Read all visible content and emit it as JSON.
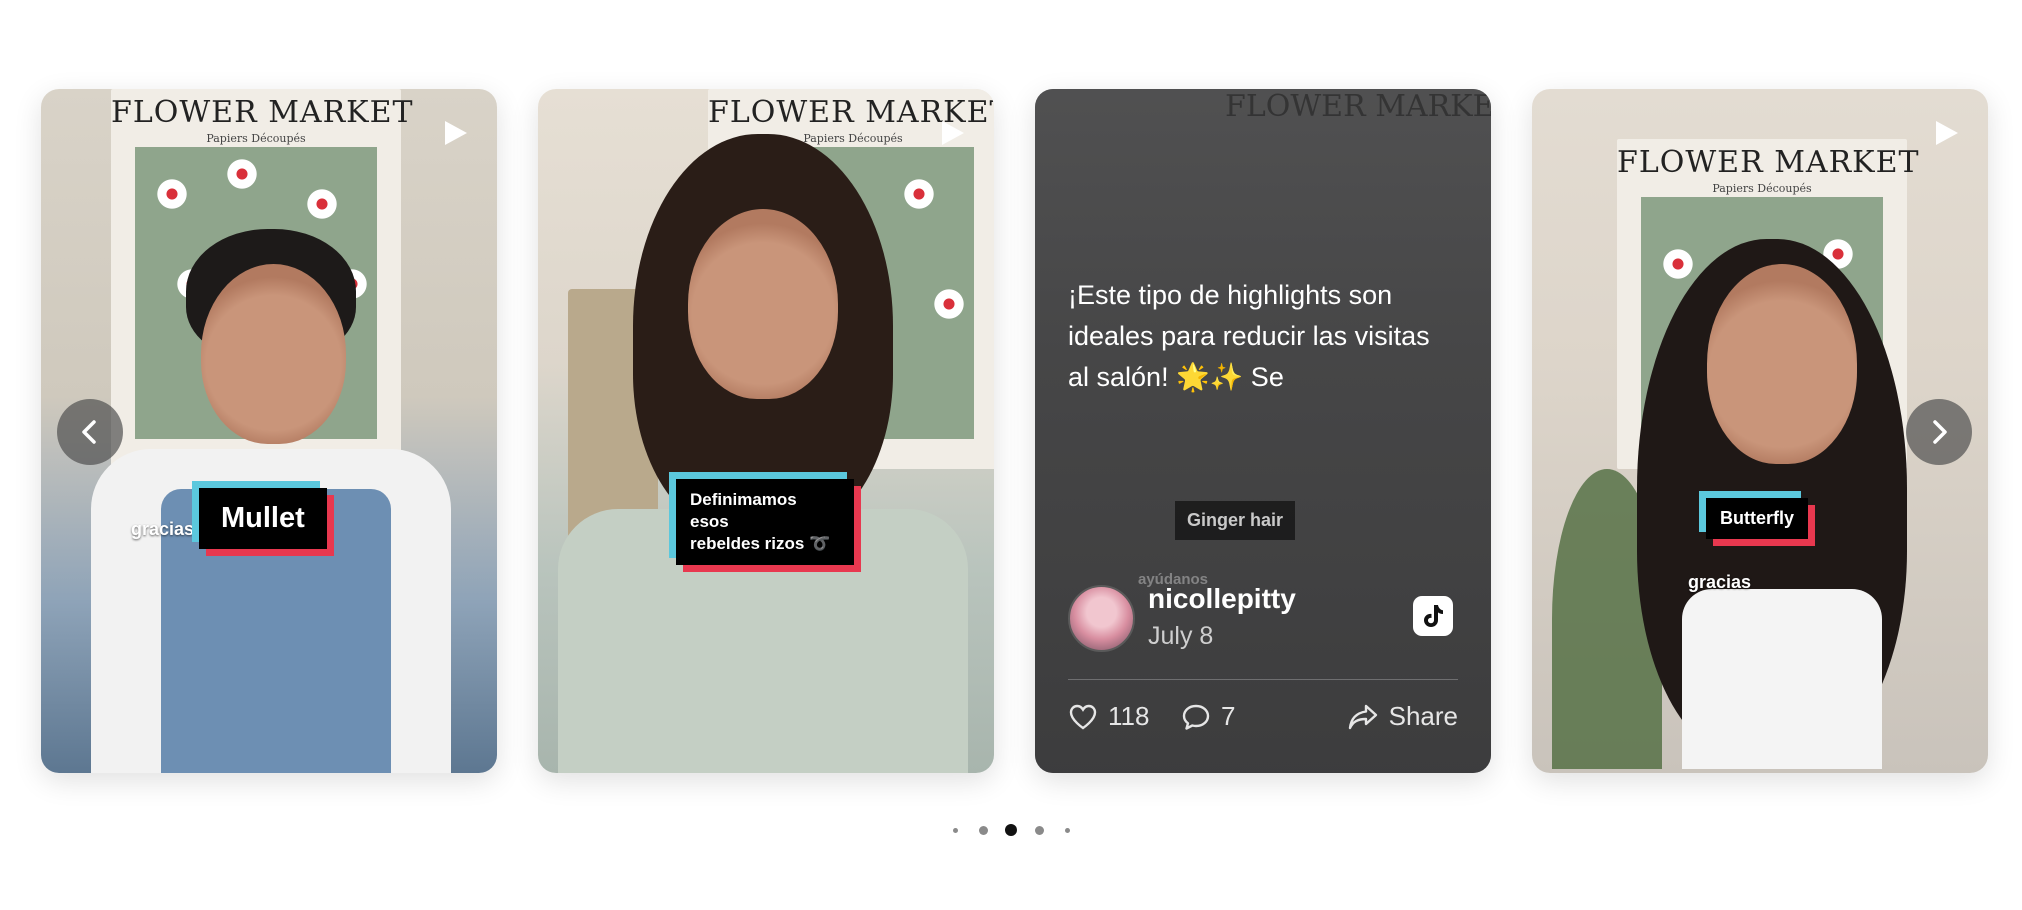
{
  "carousel": {
    "cards": [
      {
        "type": "video",
        "caption_sticker": "Mullet",
        "overlay_text": "gracias",
        "poster_title": "FLOWER MARKET",
        "poster_subtitle": "Papiers Découpés"
      },
      {
        "type": "video",
        "caption_sticker_line1": "Definimamos esos",
        "caption_sticker_line2": "rebeldes rizos ➰",
        "poster_title": "FLOWER MARKET",
        "poster_subtitle": "Papiers Découpés"
      },
      {
        "type": "info",
        "poster_title": "FLOWER MARKET",
        "caption": "¡Este tipo de highlights son ideales para reducir las visitas al salón! 🌟✨ Se",
        "tag": "Ginger hair",
        "faded_text": "ayúdanos",
        "username": "nicollepitty",
        "date": "July 8",
        "likes": "118",
        "comments": "7",
        "share_label": "Share"
      },
      {
        "type": "video",
        "caption_sticker": "Butterfly",
        "overlay_text": "gracias",
        "poster_title": "FLOWER MARKET",
        "poster_subtitle": "Papiers Découpés"
      }
    ],
    "pagination": {
      "count": 5,
      "active_index": 2
    },
    "colors": {
      "sticker_cyan": "#5bc8dd",
      "sticker_red": "#e8384f",
      "active_dot": "#111111"
    }
  }
}
